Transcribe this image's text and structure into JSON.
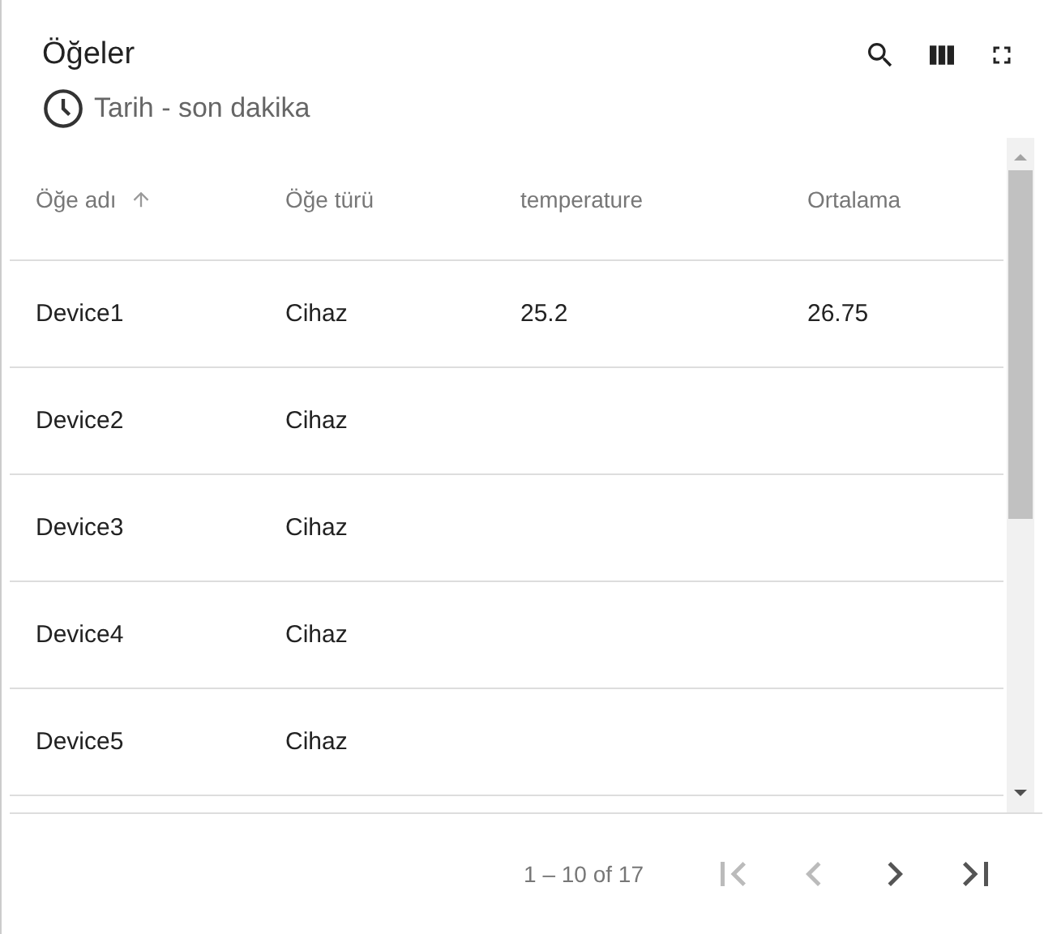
{
  "header": {
    "title": "Öğeler",
    "subtitle": "Tarih - son dakika",
    "actions": [
      {
        "kind": "search"
      },
      {
        "kind": "columns"
      },
      {
        "kind": "fullscreen"
      }
    ]
  },
  "table": {
    "columns": [
      {
        "label": "Öğe adı",
        "sorted": true
      },
      {
        "label": "Öğe türü",
        "sorted": false
      },
      {
        "label": "temperature",
        "sorted": false
      },
      {
        "label": "Ortalama",
        "sorted": false
      }
    ],
    "rows": [
      [
        "Device1",
        "Cihaz",
        "25.2",
        "26.75"
      ],
      [
        "Device2",
        "Cihaz"
      ],
      [
        "Device3",
        "Cihaz"
      ],
      [
        "Device4",
        "Cihaz"
      ],
      [
        "Device5",
        "Cihaz"
      ]
    ]
  },
  "pagination": {
    "range": "1 – 10 of 17",
    "buttons": [
      {
        "kind": "first",
        "disabled": true
      },
      {
        "kind": "prev",
        "disabled": true
      },
      {
        "kind": "next",
        "disabled": false
      },
      {
        "kind": "last",
        "disabled": false
      }
    ]
  }
}
